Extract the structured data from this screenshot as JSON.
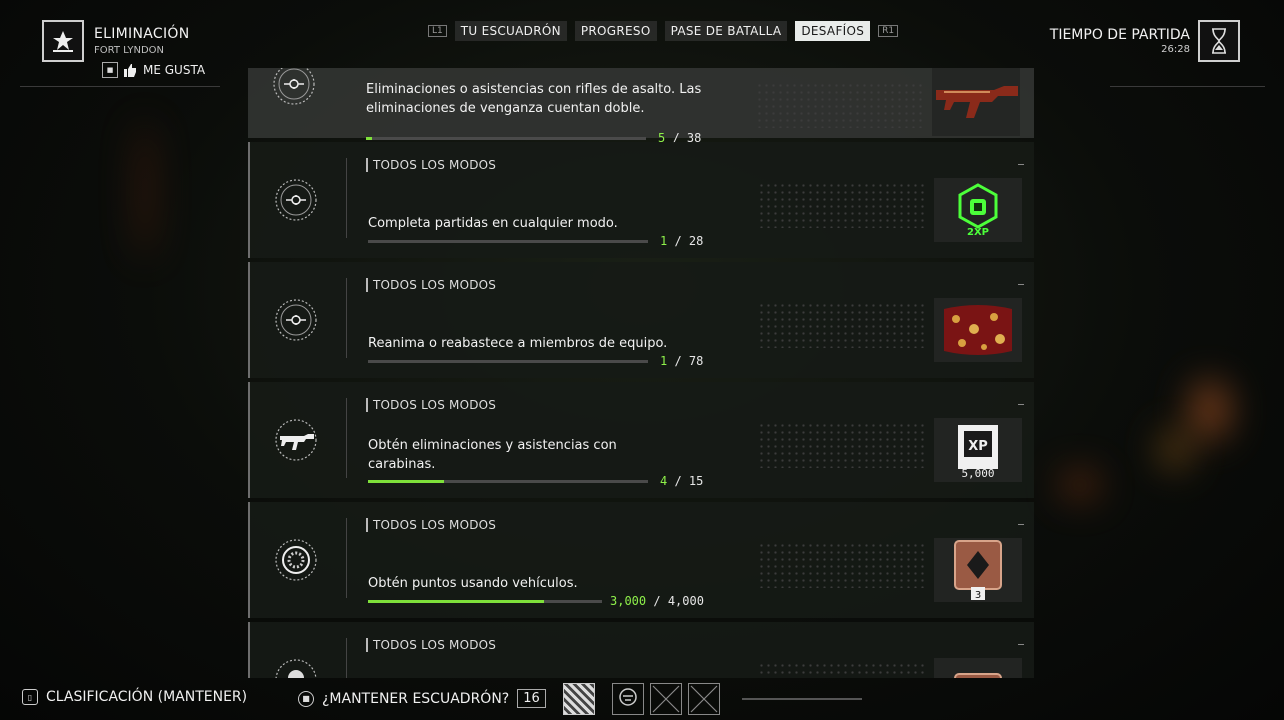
{
  "header": {
    "mode_title": "ELIMINACIÓN",
    "map_name": "FORT LYNDON",
    "like_label": "ME GUSTA",
    "tabs": [
      {
        "label": "TU ESCUADRÓN",
        "active": false
      },
      {
        "label": "PROGRESO",
        "active": false
      },
      {
        "label": "PASE DE BATALLA",
        "active": false
      },
      {
        "label": "DESAFÍOS",
        "active": true
      }
    ],
    "left_shoulder": "L1",
    "right_shoulder": "R1",
    "time_label": "TIEMPO DE PARTIDA",
    "time_value": "26:28"
  },
  "challenges": [
    {
      "mode": "",
      "description": "Eliminaciones o asistencias con rifles de asalto. Las eliminaciones de venganza cuentan doble.",
      "current": "5",
      "total": "38",
      "progress": 0.13,
      "emblem": "crosshair-emblem",
      "reward": "weapon-skin"
    },
    {
      "mode": "TODOS LOS MODOS",
      "description": "Completa partidas en cualquier modo.",
      "current": "1",
      "total": "28",
      "progress": 0.0,
      "emblem": "crosshair-emblem",
      "reward": "2xp-token",
      "reward_text": "2XP"
    },
    {
      "mode": "TODOS LOS MODOS",
      "description": "Reanima o reabastece a miembros de equipo.",
      "current": "1",
      "total": "78",
      "progress": 0.0,
      "emblem": "crosshair-emblem",
      "reward": "camo-skin"
    },
    {
      "mode": "TODOS LOS MODOS",
      "description": "Obtén eliminaciones y asistencias con carabinas.",
      "current": "4",
      "total": "15",
      "progress": 0.27,
      "emblem": "carbine-emblem",
      "reward": "xp-token",
      "reward_text": "5,000",
      "reward_label": "XP"
    },
    {
      "mode": "TODOS LOS MODOS",
      "description": "Obtén puntos usando vehículos.",
      "current": "3,000",
      "total": "4,000",
      "progress": 0.75,
      "emblem": "vehicle-emblem",
      "reward": "rank-badge",
      "reward_text": "3"
    },
    {
      "mode": "TODOS LOS MODOS",
      "description": "",
      "current": "",
      "total": "",
      "progress": 0,
      "emblem": "skull-emblem",
      "reward": "rank-badge"
    }
  ],
  "footer": {
    "scoreboard_label": "CLASIFICACIÓN (MANTENER)",
    "keep_squad_label": "¿MANTENER ESCUADRÓN?",
    "keep_squad_count": "16"
  },
  "colors": {
    "progress": "#7ee03a",
    "accent_xp": "#4cff3a"
  }
}
